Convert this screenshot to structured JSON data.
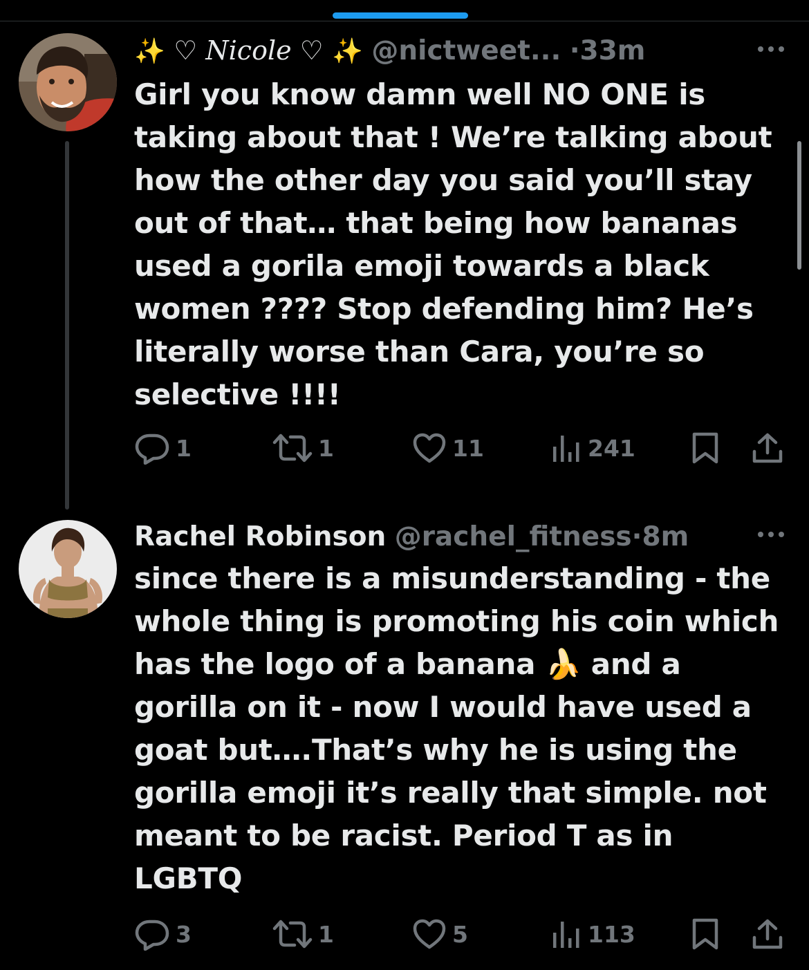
{
  "colors": {
    "background": "#000000",
    "text": "#e7e9ea",
    "secondary": "#71767b",
    "accent": "#1d9bf0",
    "thread_line": "#333639"
  },
  "tweets": [
    {
      "display_name": "✨ ♡ Nicole ♡ ✨",
      "name_parts": {
        "sparkle_left": "✨",
        "name": "♡ Nicole ♡",
        "sparkle_right": "✨"
      },
      "handle": "@nictweet...",
      "dot": "·",
      "time": "33m",
      "avatar_icon": "avatar-photo-man",
      "lines": [
        "Girl you know damn well NO ONE is",
        "taking about that ! We’re talking about",
        "how the other day you said you’ll stay",
        "out of that… that being how bananas",
        "used a gorila emoji towards a black",
        "women ???? Stop defending him? He’s",
        "literally worse than Cara, you’re so",
        "selective !!!!"
      ],
      "replies": "1",
      "retweets": "1",
      "likes": "11",
      "views": "241"
    },
    {
      "display_name": "Rachel Robinson",
      "handle": "@rachel_fitness",
      "dot": "·",
      "time": "8m",
      "avatar_icon": "avatar-photo-woman",
      "lines": [
        "since there is a misunderstanding - the",
        "whole thing is promoting his coin which",
        "has the logo of a banana 🍌 and a",
        "gorilla on it - now I would have used a",
        "goat but….That’s why he is using the",
        "gorilla emoji it’s really that simple.  not",
        "meant to be racist. Period T as in",
        "LGBTQ"
      ],
      "replies": "3",
      "retweets": "1",
      "likes": "5",
      "views": "113"
    }
  ]
}
